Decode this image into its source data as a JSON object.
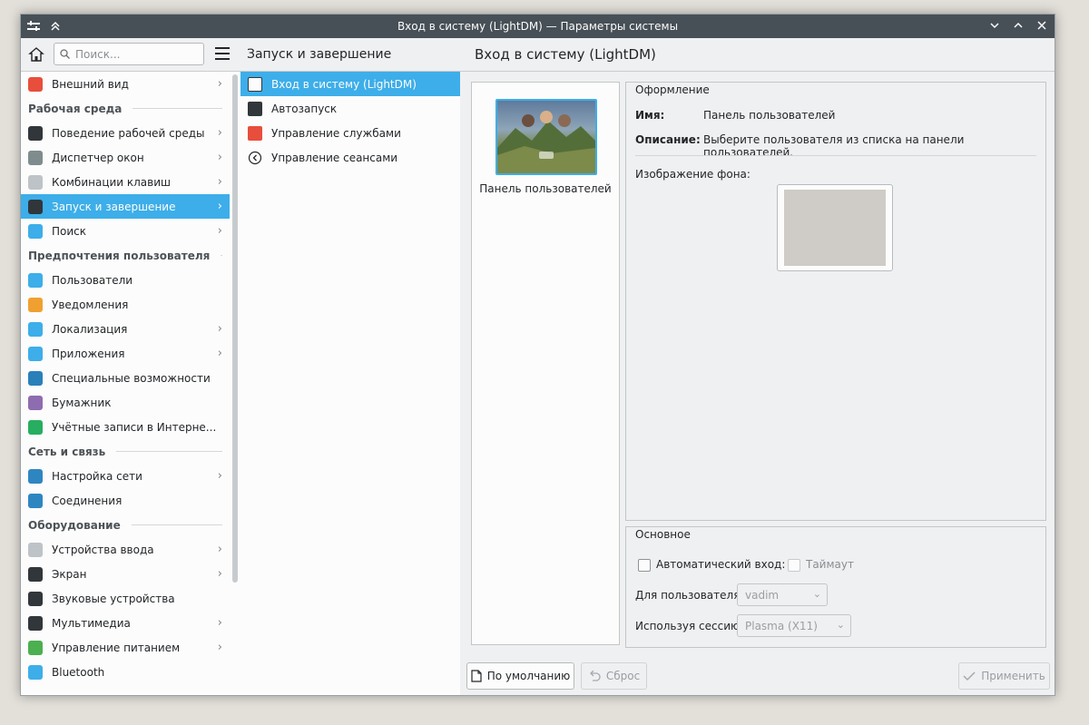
{
  "window": {
    "title": "Вход в систему (LightDM) — Параметры системы"
  },
  "sidebar": {
    "search_placeholder": "Поиск...",
    "items": [
      {
        "type": "item",
        "label": "Внешний вид",
        "icon": "appearance-icon",
        "color": "#e84e3c",
        "chevron": true
      },
      {
        "type": "category",
        "label": "Рабочая среда"
      },
      {
        "type": "item",
        "label": "Поведение рабочей среды",
        "icon": "workspace-behavior-icon",
        "color": "#31363b",
        "chevron": true
      },
      {
        "type": "item",
        "label": "Диспетчер окон",
        "icon": "window-manager-icon",
        "color": "#7f8c8d",
        "chevron": true
      },
      {
        "type": "item",
        "label": "Комбинации клавиш",
        "icon": "keyboard-shortcuts-icon",
        "color": "#bdc3c7",
        "chevron": true
      },
      {
        "type": "item",
        "label": "Запуск и завершение",
        "icon": "startup-shutdown-icon",
        "color": "#31363b",
        "chevron": true,
        "active": true
      },
      {
        "type": "item",
        "label": "Поиск",
        "icon": "search-settings-icon",
        "color": "#3daee9",
        "chevron": true
      },
      {
        "type": "category",
        "label": "Предпочтения пользователя"
      },
      {
        "type": "item",
        "label": "Пользователи",
        "icon": "users-icon",
        "color": "#3daee9",
        "chevron": false
      },
      {
        "type": "item",
        "label": "Уведомления",
        "icon": "notifications-icon",
        "color": "#f0a030",
        "chevron": false
      },
      {
        "type": "item",
        "label": "Локализация",
        "icon": "localization-icon",
        "color": "#3daee9",
        "chevron": true
      },
      {
        "type": "item",
        "label": "Приложения",
        "icon": "applications-icon",
        "color": "#3daee9",
        "chevron": true
      },
      {
        "type": "item",
        "label": "Специальные возможности",
        "icon": "accessibility-icon",
        "color": "#2980b9",
        "chevron": false
      },
      {
        "type": "item",
        "label": "Бумажник",
        "icon": "wallet-icon",
        "color": "#8e6cb0",
        "chevron": false
      },
      {
        "type": "item",
        "label": "Учётные записи в Интерне...",
        "icon": "online-accounts-icon",
        "color": "#27ae60",
        "chevron": false
      },
      {
        "type": "category",
        "label": "Сеть и связь"
      },
      {
        "type": "item",
        "label": "Настройка сети",
        "icon": "network-settings-icon",
        "color": "#2e86c1",
        "chevron": true
      },
      {
        "type": "item",
        "label": "Соединения",
        "icon": "connections-icon",
        "color": "#2e86c1",
        "chevron": false
      },
      {
        "type": "category",
        "label": "Оборудование"
      },
      {
        "type": "item",
        "label": "Устройства ввода",
        "icon": "mouse-icon",
        "color": "#bdc3c7",
        "chevron": true
      },
      {
        "type": "item",
        "label": "Экран",
        "icon": "display-icon",
        "color": "#31363b",
        "chevron": true
      },
      {
        "type": "item",
        "label": "Звуковые устройства",
        "icon": "speaker-icon",
        "color": "#31363b",
        "chevron": false
      },
      {
        "type": "item",
        "label": "Мультимедиа",
        "icon": "multimedia-icon",
        "color": "#31363b",
        "chevron": true
      },
      {
        "type": "item",
        "label": "Управление питанием",
        "icon": "power-icon",
        "color": "#4caf50",
        "chevron": true
      },
      {
        "type": "item",
        "label": "Bluetooth",
        "icon": "bluetooth-icon",
        "color": "#3daee9",
        "chevron": false
      }
    ]
  },
  "middle": {
    "title": "Запуск и завершение",
    "items": [
      {
        "label": "Вход в систему (LightDM)",
        "icon": "login-screen-icon",
        "active": true
      },
      {
        "label": "Автозапуск",
        "icon": "autostart-icon",
        "active": false
      },
      {
        "label": "Управление службами",
        "icon": "services-icon",
        "active": false
      },
      {
        "label": "Управление сеансами",
        "icon": "sessions-icon",
        "active": false
      }
    ]
  },
  "main": {
    "title": "Вход в систему (LightDM)",
    "theme_label": "Панель пользователей",
    "appearance": {
      "group_title": "Оформление",
      "name_key": "Имя:",
      "name_value": "Панель пользователей",
      "desc_key": "Описание:",
      "desc_value": "Выберите пользователя из списка на панели пользователей.",
      "bg_label": "Изображение фона:"
    },
    "basic": {
      "group_title": "Основное",
      "autologin_label": "Автоматический вход:",
      "timeout_label": "Таймаут",
      "user_label": "Для пользователя:",
      "user_value": "vadim",
      "session_label": "Используя сессию:",
      "session_value": "Plasma (X11)"
    },
    "buttons": {
      "defaults": "По умолчанию",
      "reset": "Сброс",
      "apply": "Применить"
    }
  },
  "colors": {
    "accent": "#3daee9",
    "titlebar": "#475057"
  }
}
